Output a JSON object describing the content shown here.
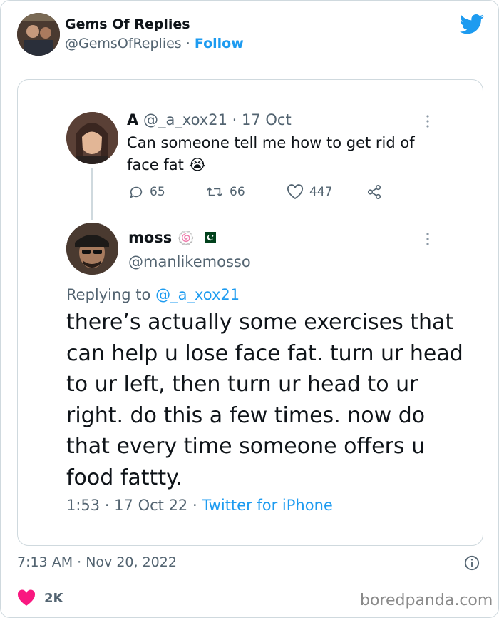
{
  "header": {
    "display_name": "Gems Of Replies",
    "handle": "@GemsOfReplies",
    "separator": "·",
    "follow_label": "Follow",
    "brand_icon": "twitter-bird-icon",
    "brand_color": "#1d9bf0"
  },
  "quoted_card": {
    "original_tweet": {
      "name": "A",
      "handle": "@_a_xox21",
      "date": "· 17 Oct",
      "text": "Can someone tell me how to get rid of face fat 😭",
      "replies": "65",
      "retweets": "66",
      "likes": "447"
    },
    "reply_tweet": {
      "name": "moss",
      "name_emoji": "🍥",
      "flag_icon": "pakistan-flag-icon",
      "handle": "@manlikemosso",
      "replying_prefix": "Replying to",
      "replying_handle": "@_a_xox21",
      "text": "there’s actually some exercises that can help u lose face fat. turn ur head to ur left, then turn ur head to ur right. do this a few times. now do that every time someone offers u food fattty.",
      "time_date": "1:53 · 17 Oct 22 ·",
      "source": "Twitter for iPhone"
    }
  },
  "footer": {
    "timestamp": "7:13 AM · Nov 20, 2022",
    "like_count": "2K",
    "like_color": "#f91880"
  },
  "watermark": "boredpanda.com"
}
